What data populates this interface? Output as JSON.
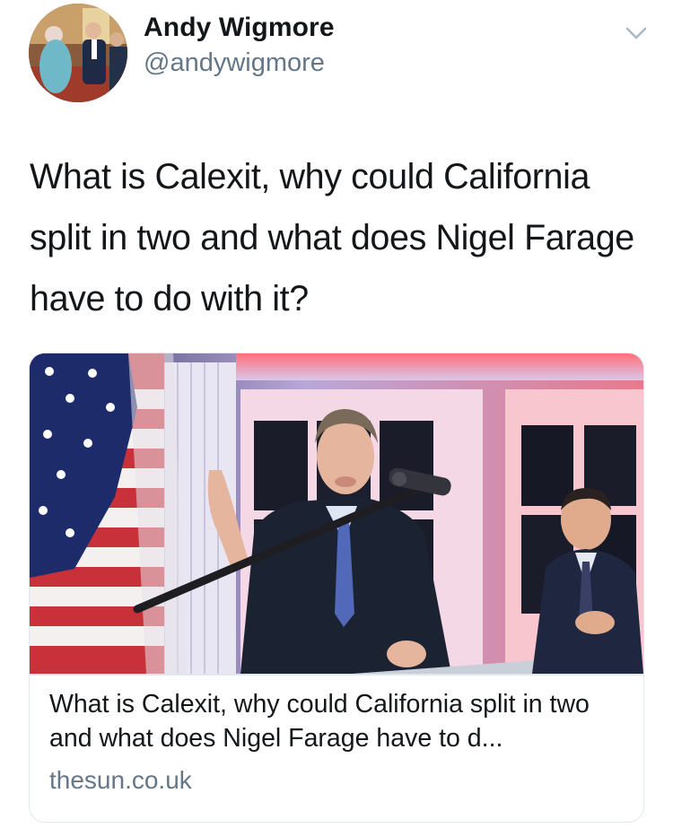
{
  "author": {
    "name": "Andy Wigmore",
    "handle": "@andywigmore",
    "avatar_icon": "profile-photo"
  },
  "menu": {
    "icon": "chevron-down-icon"
  },
  "tweet": {
    "text": "What is Calexit, why could California split in two and what does Nigel Farage have to do with it?"
  },
  "card": {
    "image_icon": "article-photo",
    "title": "What is Calexit, why could California split in two and what does Nigel Farage have to d...",
    "domain": "thesun.co.uk"
  },
  "colors": {
    "text_primary": "#14171a",
    "text_secondary": "#657786",
    "border": "#e1e8ed"
  }
}
